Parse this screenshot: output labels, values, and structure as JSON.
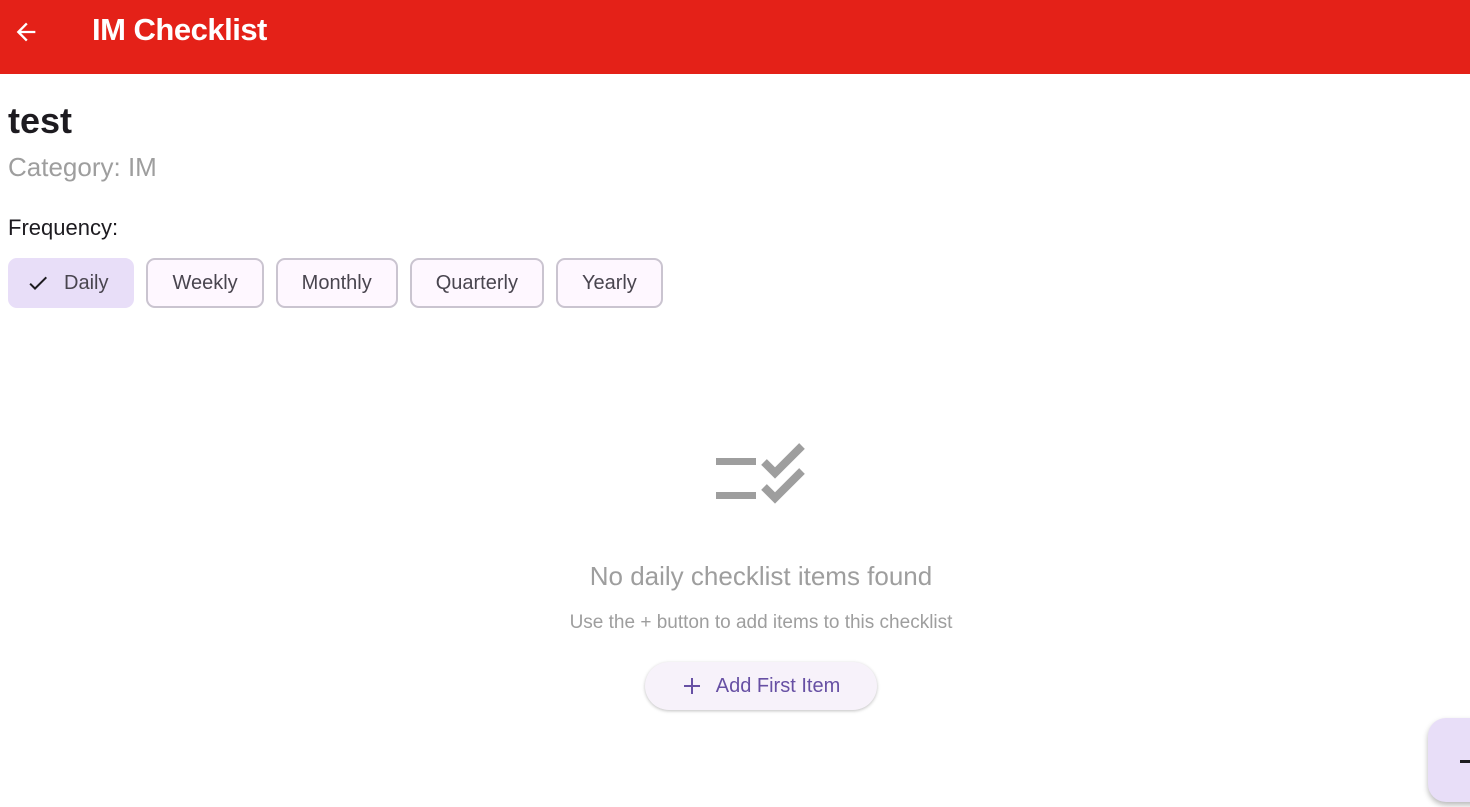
{
  "appbar": {
    "title": "IM Checklist",
    "back_icon": "arrow-left-icon",
    "color": "#e42118"
  },
  "checklist": {
    "name": "test",
    "category": "Category: IM"
  },
  "frequency": {
    "label": "Frequency:",
    "options": [
      {
        "label": "Daily",
        "selected": true
      },
      {
        "label": "Weekly",
        "selected": false
      },
      {
        "label": "Monthly",
        "selected": false
      },
      {
        "label": "Quarterly",
        "selected": false
      },
      {
        "label": "Yearly",
        "selected": false
      }
    ]
  },
  "empty_state": {
    "icon": "checklist-icon",
    "title": "No daily checklist items found",
    "subtitle": "Use the + button to add items to this checklist",
    "button_label": "Add First Item",
    "button_icon": "plus-icon"
  },
  "fab": {
    "icon": "plus-icon"
  },
  "colors": {
    "accent": "#6750a4",
    "chip_selected": "#e8def8",
    "muted_text": "#9e9e9e"
  }
}
